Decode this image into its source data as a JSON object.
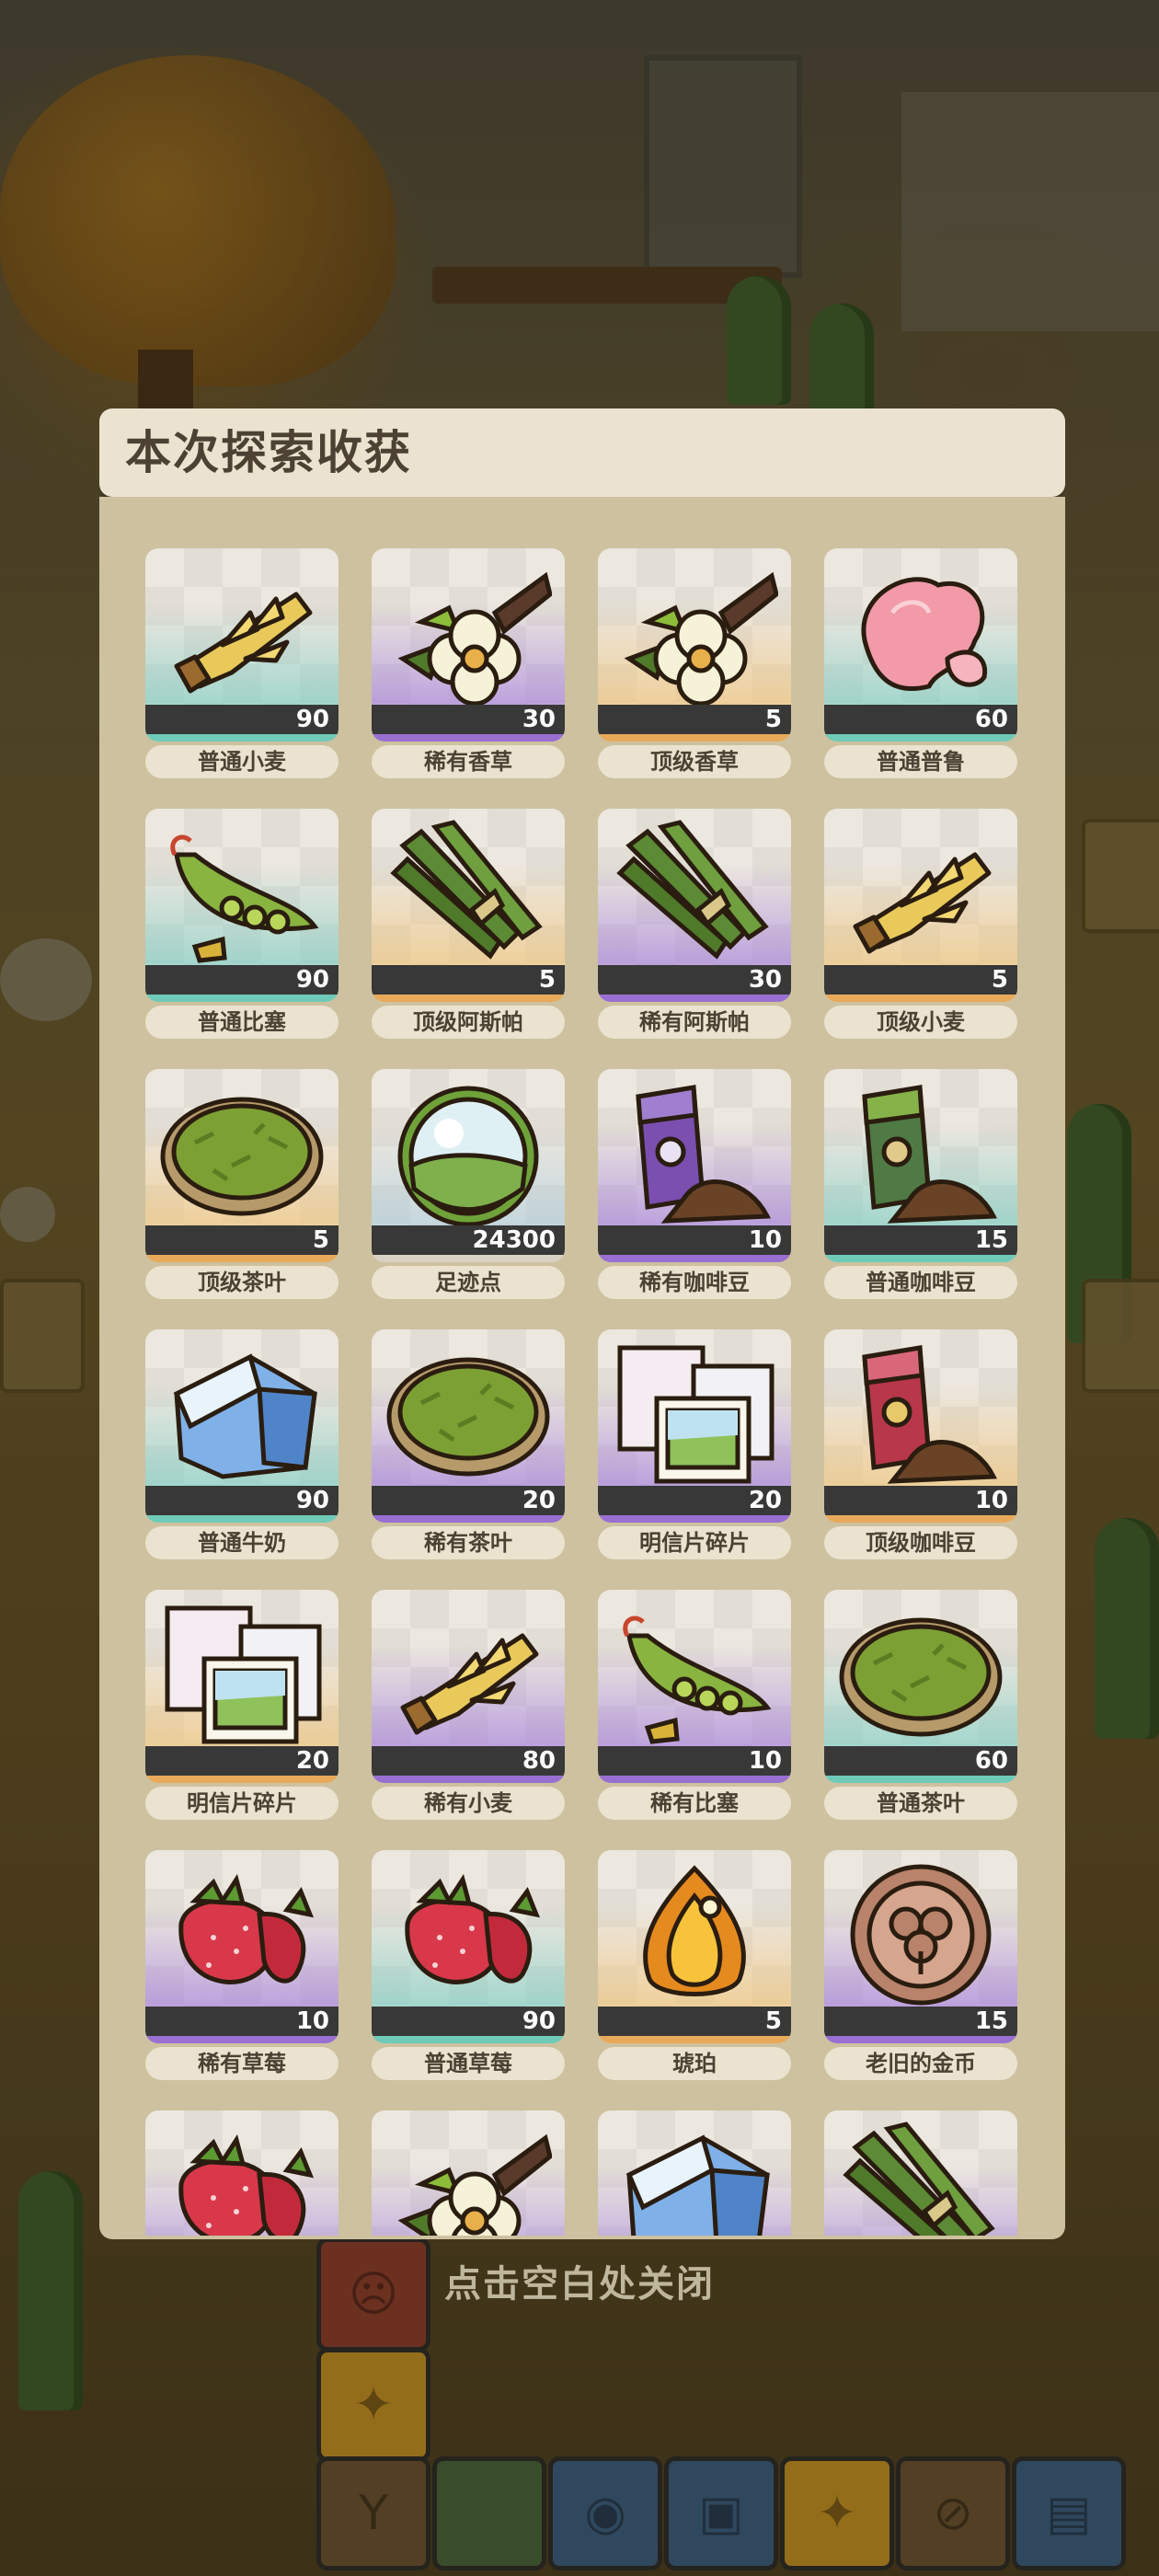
{
  "dialog": {
    "title": "本次探索收获"
  },
  "close_hint": "点击空白处关闭",
  "colors": {
    "common": "#6fcab8",
    "rare": "#9a6fd2",
    "top": "#e8a95a",
    "panel": "#cdc19f",
    "header": "#ebe3d0"
  },
  "items": [
    {
      "name": "普通小麦",
      "qty": "90",
      "rarity": "common",
      "icon": "wheat-icon"
    },
    {
      "name": "稀有香草",
      "qty": "30",
      "rarity": "rare",
      "icon": "vanilla-flower-icon"
    },
    {
      "name": "顶级香草",
      "qty": "5",
      "rarity": "top",
      "icon": "vanilla-flower-icon"
    },
    {
      "name": "普通普鲁",
      "qty": "60",
      "rarity": "common",
      "icon": "pink-mushroom-icon"
    },
    {
      "name": "普通比塞",
      "qty": "90",
      "rarity": "common",
      "icon": "pea-pod-icon"
    },
    {
      "name": "顶级阿斯帕",
      "qty": "5",
      "rarity": "top",
      "icon": "asparagus-icon"
    },
    {
      "name": "稀有阿斯帕",
      "qty": "30",
      "rarity": "rare",
      "icon": "asparagus-icon"
    },
    {
      "name": "顶级小麦",
      "qty": "5",
      "rarity": "top",
      "icon": "wheat-icon"
    },
    {
      "name": "顶级茶叶",
      "qty": "5",
      "rarity": "top",
      "icon": "tea-leaves-bowl-icon"
    },
    {
      "name": "足迹点",
      "qty": "24300",
      "rarity": "special",
      "icon": "footprint-orb-icon"
    },
    {
      "name": "稀有咖啡豆",
      "qty": "10",
      "rarity": "rare",
      "icon": "coffee-bag-purple-icon"
    },
    {
      "name": "普通咖啡豆",
      "qty": "15",
      "rarity": "common",
      "icon": "coffee-bag-green-icon"
    },
    {
      "name": "普通牛奶",
      "qty": "90",
      "rarity": "common",
      "icon": "milk-carton-icon"
    },
    {
      "name": "稀有茶叶",
      "qty": "20",
      "rarity": "rare",
      "icon": "tea-leaves-bowl-icon"
    },
    {
      "name": "明信片碎片",
      "qty": "20",
      "rarity": "rare",
      "icon": "postcard-icon"
    },
    {
      "name": "顶级咖啡豆",
      "qty": "10",
      "rarity": "top",
      "icon": "coffee-bag-red-icon"
    },
    {
      "name": "明信片碎片",
      "qty": "20",
      "rarity": "top",
      "icon": "postcard-icon"
    },
    {
      "name": "稀有小麦",
      "qty": "80",
      "rarity": "rare",
      "icon": "wheat-icon"
    },
    {
      "name": "稀有比塞",
      "qty": "10",
      "rarity": "rare",
      "icon": "pea-pod-icon"
    },
    {
      "name": "普通茶叶",
      "qty": "60",
      "rarity": "common",
      "icon": "tea-leaves-bowl-icon"
    },
    {
      "name": "稀有草莓",
      "qty": "10",
      "rarity": "rare",
      "icon": "strawberry-icon"
    },
    {
      "name": "普通草莓",
      "qty": "90",
      "rarity": "common",
      "icon": "strawberry-icon"
    },
    {
      "name": "琥珀",
      "qty": "5",
      "rarity": "top",
      "icon": "amber-icon"
    },
    {
      "name": "老旧的金币",
      "qty": "15",
      "rarity": "rare",
      "icon": "old-coin-icon"
    },
    {
      "name": "",
      "qty": "",
      "rarity": "rare",
      "icon": "strawberry-icon"
    },
    {
      "name": "",
      "qty": "",
      "rarity": "rare",
      "icon": "vanilla-flower-icon"
    },
    {
      "name": "",
      "qty": "",
      "rarity": "rare",
      "icon": "milk-carton-icon"
    },
    {
      "name": "",
      "qty": "",
      "rarity": "rare",
      "icon": "asparagus-icon"
    }
  ]
}
